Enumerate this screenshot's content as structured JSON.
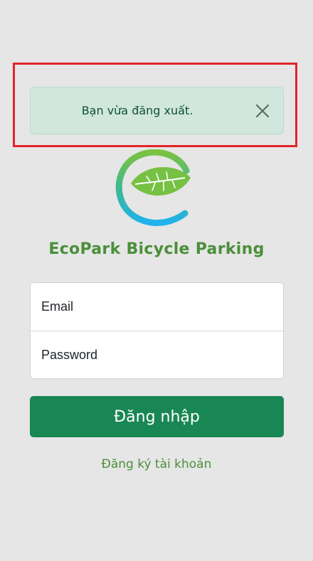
{
  "alert": {
    "message": "Bạn vừa đăng xuất.",
    "close_icon": "close-icon",
    "background": "#d1e7dd",
    "highlight_color": "#e3242b"
  },
  "logo": {
    "icon": "leaf-e-logo-icon",
    "colors": [
      "#7cc242",
      "#29b6e8"
    ]
  },
  "brand": {
    "name": "EcoPark Bicycle Parking",
    "color": "#4a8f3a"
  },
  "login_form": {
    "email_placeholder": "Email",
    "email_value": "",
    "password_placeholder": "Password",
    "password_value": "",
    "submit_label": "Đăng nhập",
    "submit_color": "#198754"
  },
  "register": {
    "label": "Đăng ký tài khoản"
  }
}
